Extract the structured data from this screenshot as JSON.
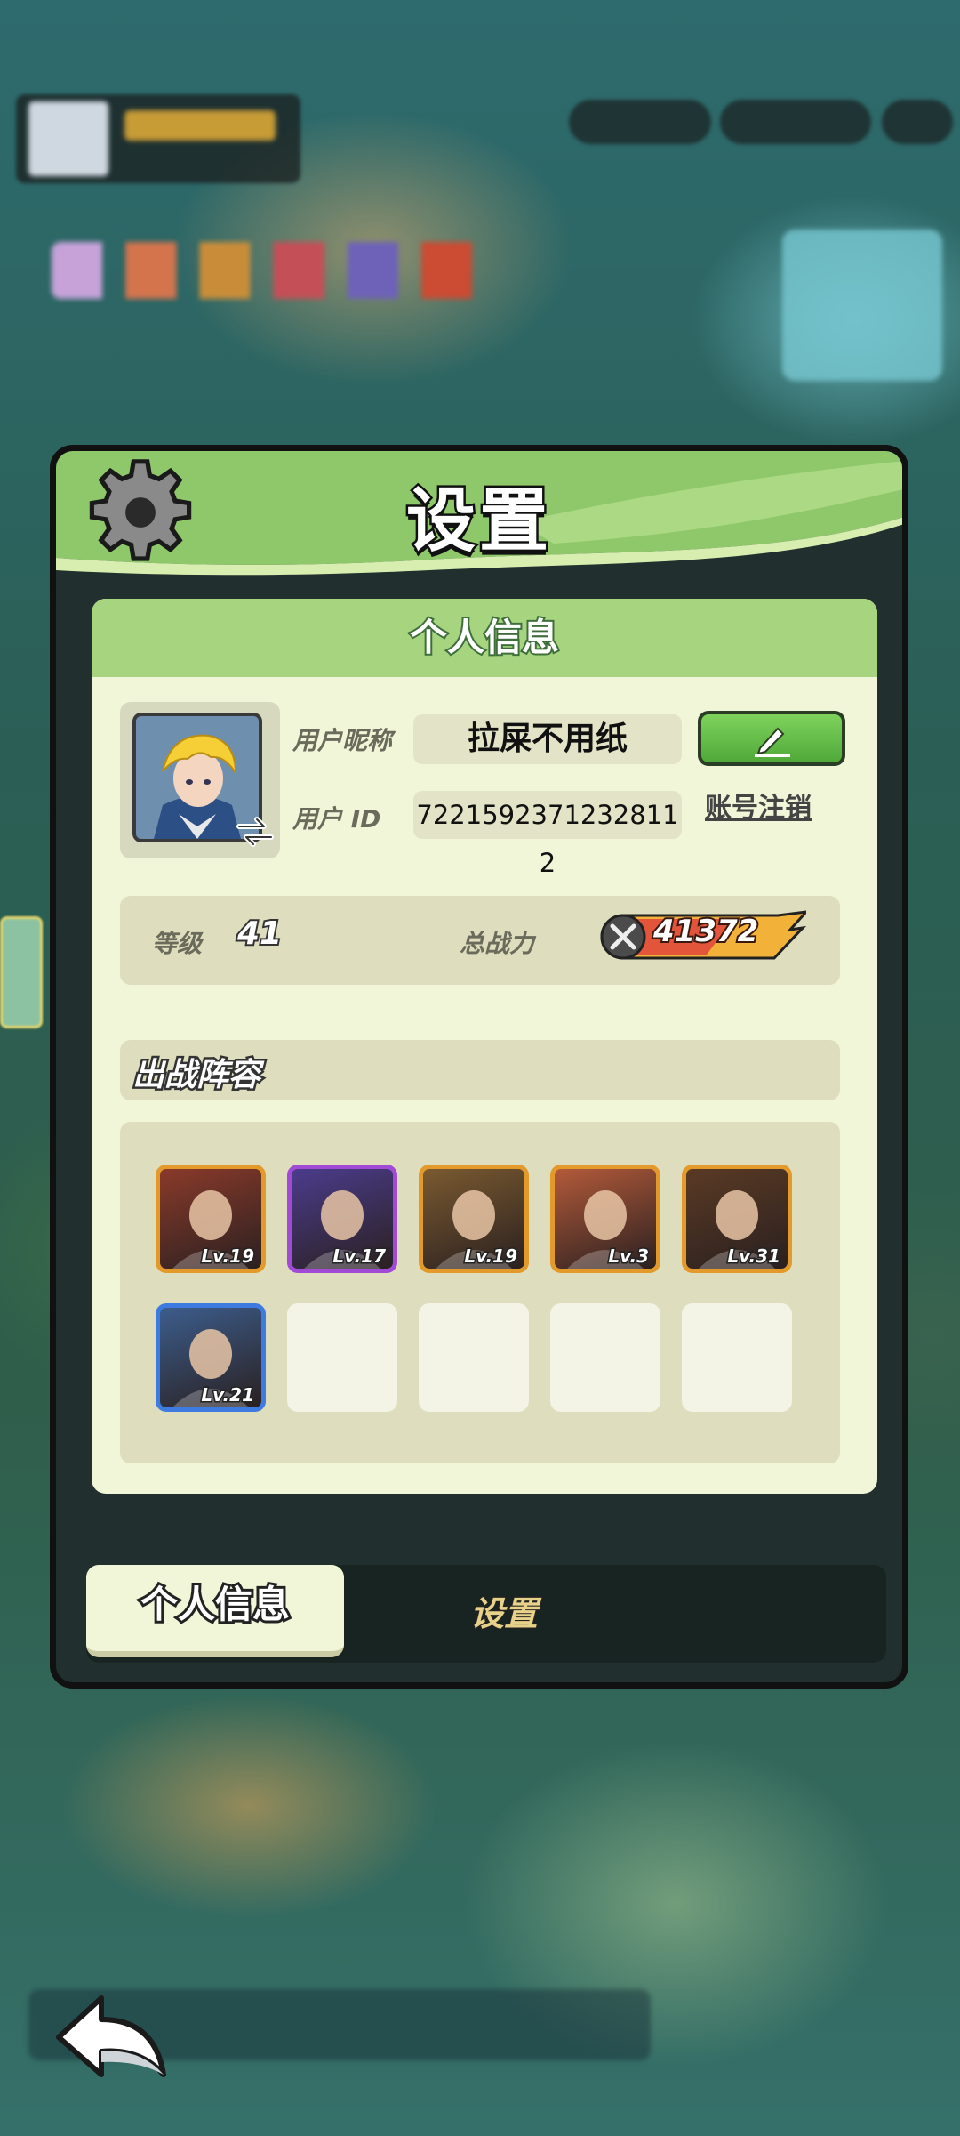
{
  "panel": {
    "title": "设置"
  },
  "profile": {
    "header": "个人信息",
    "nickname_label": "用户昵称",
    "nickname": "拉屎不用纸",
    "id_label": "用户 ID",
    "user_id": "7221592371232811 2",
    "cancel_account": "账号注销"
  },
  "stats": {
    "level_label": "等级",
    "level": "41",
    "power_label": "总战力",
    "power": "41372"
  },
  "lineup": {
    "title": "出战阵容",
    "heroes": [
      {
        "level": "Lv.19",
        "rarity": "orange",
        "color": "#8a3a2a"
      },
      {
        "level": "Lv.17",
        "rarity": "purple",
        "color": "#4b3c8c"
      },
      {
        "level": "Lv.19",
        "rarity": "orange",
        "color": "#7a5a30"
      },
      {
        "level": "Lv.3",
        "rarity": "orange",
        "color": "#b35a3a"
      },
      {
        "level": "Lv.31",
        "rarity": "orange",
        "color": "#5a3a24"
      },
      {
        "level": "Lv.21",
        "rarity": "blue",
        "color": "#3c5d8c"
      }
    ],
    "empty_slots": 4
  },
  "tabs": {
    "active": "个人信息",
    "inactive": "设置"
  },
  "colors": {
    "panel_green": "#a6d47f",
    "card_bg": "#f1f6d9",
    "edit_green": "#5ab942",
    "tab_bar": "#182422"
  }
}
